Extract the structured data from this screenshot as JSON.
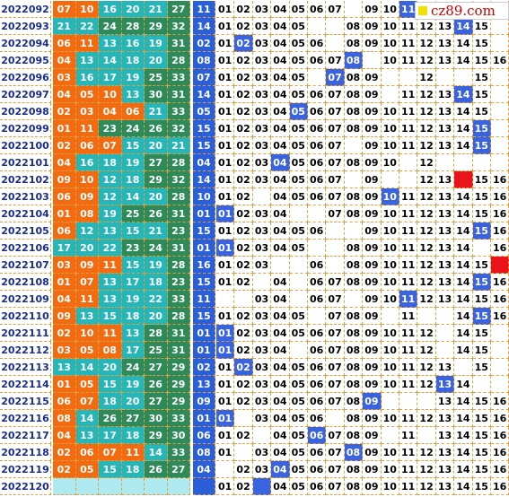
{
  "colors": {
    "red_zone": "#f26b10",
    "teal_zone": "#27b6b8",
    "green_zone": "#2f8a5a",
    "blue_zone": "#2b5fd9",
    "hit_blue": "#3a63e0",
    "hit_red": "#e8141a",
    "period_text": "#1a2e8a",
    "grid_line": "#e0a040"
  },
  "watermark": {
    "text": "cz89.com",
    "icon": "yellow-square-icon"
  },
  "chart_data": {
    "type": "table",
    "columns_right": [
      "01",
      "02",
      "03",
      "04",
      "05",
      "06",
      "07",
      "08",
      "09",
      "10",
      "11",
      "12",
      "13",
      "14",
      "15",
      "16"
    ],
    "rows": [
      {
        "period": "2022092",
        "front": [
          "07",
          "10",
          "16",
          "20",
          "21",
          "27"
        ],
        "back": "11",
        "right": [
          "01",
          "02",
          "03",
          "04",
          "05",
          "06",
          "07",
          "",
          "09",
          "10",
          "11",
          "",
          "",
          "",
          "",
          ""
        ],
        "hits": [
          11
        ]
      },
      {
        "period": "2022093",
        "front": [
          "21",
          "22",
          "24",
          "28",
          "29",
          "32"
        ],
        "back": "14",
        "right": [
          "01",
          "02",
          "03",
          "04",
          "05",
          "",
          "",
          "08",
          "09",
          "10",
          "11",
          "12",
          "13",
          "14",
          "15",
          ""
        ],
        "hits": [
          14
        ]
      },
      {
        "period": "2022094",
        "front": [
          "06",
          "11",
          "13",
          "16",
          "19",
          "31"
        ],
        "back": "02",
        "right": [
          "01",
          "02",
          "03",
          "04",
          "05",
          "06",
          "",
          "08",
          "09",
          "10",
          "11",
          "12",
          "13",
          "14",
          "15",
          ""
        ],
        "hits": [
          2
        ]
      },
      {
        "period": "2022095",
        "front": [
          "04",
          "13",
          "14",
          "18",
          "20",
          "28"
        ],
        "back": "08",
        "right": [
          "01",
          "02",
          "03",
          "04",
          "05",
          "06",
          "07",
          "08",
          "",
          "10",
          "11",
          "12",
          "13",
          "14",
          "15",
          "16"
        ],
        "hits": [
          8
        ]
      },
      {
        "period": "2022096",
        "front": [
          "03",
          "16",
          "17",
          "19",
          "25",
          "33"
        ],
        "back": "07",
        "right": [
          "01",
          "02",
          "03",
          "04",
          "05",
          "",
          "07",
          "08",
          "09",
          "",
          "",
          "12",
          "",
          "",
          "15",
          ""
        ],
        "hits": [
          7
        ]
      },
      {
        "period": "2022097",
        "front": [
          "04",
          "05",
          "10",
          "13",
          "30",
          "31"
        ],
        "back": "14",
        "right": [
          "01",
          "02",
          "03",
          "04",
          "05",
          "06",
          "07",
          "08",
          "09",
          "",
          "11",
          "12",
          "13",
          "14",
          "15",
          ""
        ],
        "hits": [
          14
        ]
      },
      {
        "period": "2022098",
        "front": [
          "02",
          "03",
          "04",
          "06",
          "21",
          "33"
        ],
        "back": "05",
        "right": [
          "01",
          "02",
          "03",
          "04",
          "05",
          "06",
          "07",
          "08",
          "09",
          "10",
          "11",
          "12",
          "13",
          "14",
          "15",
          ""
        ],
        "hits": [
          5
        ]
      },
      {
        "period": "2022099",
        "front": [
          "01",
          "11",
          "23",
          "24",
          "26",
          "32"
        ],
        "back": "15",
        "right": [
          "01",
          "02",
          "03",
          "04",
          "05",
          "06",
          "07",
          "08",
          "09",
          "10",
          "11",
          "12",
          "13",
          "14",
          "15",
          ""
        ],
        "hits": [
          15
        ]
      },
      {
        "period": "2022100",
        "front": [
          "02",
          "06",
          "07",
          "15",
          "20",
          "21"
        ],
        "back": "15",
        "right": [
          "01",
          "02",
          "03",
          "04",
          "05",
          "06",
          "07",
          "",
          "09",
          "10",
          "11",
          "12",
          "13",
          "14",
          "15",
          ""
        ],
        "hits": [
          15
        ]
      },
      {
        "period": "2022101",
        "front": [
          "04",
          "16",
          "18",
          "19",
          "27",
          "28"
        ],
        "back": "04",
        "right": [
          "01",
          "02",
          "03",
          "04",
          "05",
          "06",
          "07",
          "08",
          "09",
          "10",
          "",
          "12",
          "",
          "",
          "",
          ""
        ],
        "hits": [
          4
        ]
      },
      {
        "period": "2022102",
        "front": [
          "09",
          "10",
          "12",
          "18",
          "29",
          "32"
        ],
        "back": "14",
        "right": [
          "01",
          "02",
          "03",
          "04",
          "05",
          "06",
          "07",
          "",
          "09",
          "",
          "",
          "12",
          "13",
          "",
          "15",
          "16"
        ],
        "hits": [],
        "red_hit": 14
      },
      {
        "period": "2022103",
        "front": [
          "06",
          "09",
          "12",
          "14",
          "20",
          "28"
        ],
        "back": "10",
        "right": [
          "01",
          "02",
          "",
          "04",
          "05",
          "06",
          "07",
          "08",
          "09",
          "10",
          "11",
          "12",
          "13",
          "14",
          "15",
          "16"
        ],
        "hits": [
          10
        ]
      },
      {
        "period": "2022104",
        "front": [
          "01",
          "08",
          "19",
          "25",
          "26",
          "31"
        ],
        "back": "01",
        "right": [
          "01",
          "02",
          "03",
          "04",
          "",
          "",
          "07",
          "08",
          "09",
          "10",
          "11",
          "12",
          "13",
          "14",
          "15",
          "16"
        ],
        "hits": [
          1
        ]
      },
      {
        "period": "2022105",
        "front": [
          "06",
          "12",
          "13",
          "15",
          "21",
          "23"
        ],
        "back": "15",
        "right": [
          "01",
          "02",
          "03",
          "04",
          "05",
          "06",
          "",
          "",
          "09",
          "10",
          "11",
          "12",
          "13",
          "14",
          "15",
          "16"
        ],
        "hits": [
          15
        ]
      },
      {
        "period": "2022106",
        "front": [
          "17",
          "20",
          "22",
          "23",
          "24",
          "31"
        ],
        "back": "01",
        "right": [
          "01",
          "02",
          "03",
          "04",
          "05",
          "",
          "",
          "08",
          "09",
          "10",
          "11",
          "12",
          "13",
          "14",
          "",
          "16"
        ],
        "hits": [
          1
        ]
      },
      {
        "period": "2022107",
        "front": [
          "03",
          "09",
          "11",
          "15",
          "19",
          "28"
        ],
        "back": "16",
        "right": [
          "01",
          "02",
          "03",
          "",
          "",
          "06",
          "",
          "08",
          "09",
          "10",
          "11",
          "12",
          "13",
          "14",
          "15",
          ""
        ],
        "hits": [],
        "red_hit": 16
      },
      {
        "period": "2022108",
        "front": [
          "01",
          "07",
          "13",
          "17",
          "18",
          "23"
        ],
        "back": "15",
        "right": [
          "01",
          "02",
          "",
          "04",
          "",
          "06",
          "07",
          "08",
          "09",
          "10",
          "11",
          "12",
          "13",
          "14",
          "15",
          "16"
        ],
        "hits": [
          15
        ]
      },
      {
        "period": "2022109",
        "front": [
          "04",
          "11",
          "13",
          "19",
          "22",
          "33"
        ],
        "back": "11",
        "right": [
          "",
          "",
          "03",
          "04",
          "",
          "06",
          "07",
          "",
          "09",
          "10",
          "11",
          "12",
          "13",
          "14",
          "15",
          "16"
        ],
        "hits": [
          11
        ]
      },
      {
        "period": "2022110",
        "front": [
          "09",
          "13",
          "15",
          "18",
          "20",
          "28"
        ],
        "back": "15",
        "right": [
          "01",
          "02",
          "03",
          "04",
          "05",
          "",
          "07",
          "08",
          "09",
          "",
          "11",
          "",
          "",
          "14",
          "15",
          "16"
        ],
        "hits": [
          15
        ]
      },
      {
        "period": "2022111",
        "front": [
          "02",
          "10",
          "11",
          "13",
          "28",
          "31"
        ],
        "back": "01",
        "right": [
          "01",
          "02",
          "03",
          "04",
          "05",
          "06",
          "07",
          "08",
          "09",
          "10",
          "11",
          "12",
          "",
          "14",
          "15",
          ""
        ],
        "hits": [
          1
        ]
      },
      {
        "period": "2022112",
        "front": [
          "03",
          "05",
          "08",
          "17",
          "25",
          "31"
        ],
        "back": "01",
        "right": [
          "01",
          "02",
          "03",
          "04",
          "",
          "06",
          "07",
          "08",
          "09",
          "10",
          "11",
          "12",
          "",
          "14",
          "15",
          ""
        ],
        "hits": [
          1
        ]
      },
      {
        "period": "2022113",
        "front": [
          "13",
          "14",
          "20",
          "24",
          "27",
          "29"
        ],
        "back": "02",
        "right": [
          "01",
          "02",
          "03",
          "04",
          "05",
          "06",
          "07",
          "08",
          "09",
          "10",
          "11",
          "12",
          "13",
          "",
          "15",
          ""
        ],
        "hits": [
          2
        ]
      },
      {
        "period": "2022114",
        "front": [
          "01",
          "05",
          "15",
          "19",
          "26",
          "29"
        ],
        "back": "13",
        "right": [
          "01",
          "02",
          "03",
          "04",
          "05",
          "06",
          "07",
          "08",
          "09",
          "10",
          "11",
          "12",
          "13",
          "14",
          "",
          ""
        ],
        "hits": [
          13
        ]
      },
      {
        "period": "2022115",
        "front": [
          "06",
          "07",
          "18",
          "20",
          "27",
          "29"
        ],
        "back": "09",
        "right": [
          "01",
          "02",
          "03",
          "04",
          "05",
          "06",
          "07",
          "08",
          "09",
          "",
          "",
          "",
          "13",
          "14",
          "15",
          "16"
        ],
        "hits": [
          9
        ]
      },
      {
        "period": "2022116",
        "front": [
          "08",
          "14",
          "26",
          "27",
          "30",
          "33"
        ],
        "back": "01",
        "right": [
          "01",
          "",
          "03",
          "04",
          "05",
          "06",
          "",
          "08",
          "09",
          "10",
          "11",
          "12",
          "13",
          "14",
          "15",
          "16"
        ],
        "hits": [
          1
        ]
      },
      {
        "period": "2022117",
        "front": [
          "04",
          "13",
          "17",
          "18",
          "29",
          "30"
        ],
        "back": "06",
        "right": [
          "01",
          "02",
          "",
          "04",
          "05",
          "06",
          "07",
          "08",
          "09",
          "",
          "11",
          "",
          "13",
          "14",
          "15",
          "16"
        ],
        "hits": [
          6
        ]
      },
      {
        "period": "2022118",
        "front": [
          "02",
          "06",
          "07",
          "11",
          "14",
          "33"
        ],
        "back": "08",
        "right": [
          "01",
          "",
          "03",
          "04",
          "05",
          "06",
          "07",
          "08",
          "09",
          "10",
          "11",
          "12",
          "13",
          "14",
          "15",
          "16"
        ],
        "hits": [
          8
        ]
      },
      {
        "period": "2022119",
        "front": [
          "02",
          "05",
          "15",
          "18",
          "26",
          "27"
        ],
        "back": "04",
        "right": [
          "",
          "02",
          "03",
          "04",
          "05",
          "06",
          "07",
          "08",
          "09",
          "10",
          "11",
          "12",
          "13",
          "14",
          "15",
          "16"
        ],
        "hits": [
          4
        ]
      },
      {
        "period": "2022120",
        "front": [
          "",
          "",
          "",
          "",
          "",
          ""
        ],
        "back": "",
        "right": [
          "01",
          "02",
          "",
          "04",
          "05",
          "06",
          "07",
          "08",
          "09",
          "10",
          "11",
          "12",
          "13",
          "14",
          "15",
          "16"
        ],
        "hits": []
      }
    ]
  }
}
